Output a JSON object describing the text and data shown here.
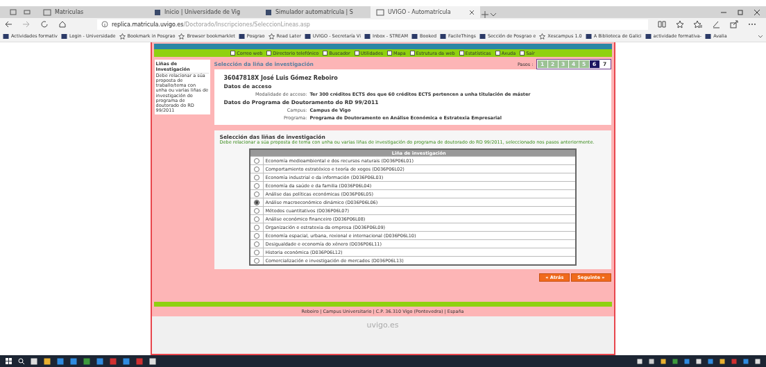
{
  "browser": {
    "tabs": [
      {
        "label": "Matriculas",
        "selected": false
      },
      {
        "label": "Inicio | Universidade de Vig",
        "selected": false
      },
      {
        "label": "Simulador automatrícula | S",
        "selected": false
      },
      {
        "label": "UVIGO - Automatrícula",
        "selected": true
      }
    ],
    "address": {
      "host": "replica.matricula.uvigo.es",
      "path": "/Doctorado/Inscripciones/SeleccionLineas.asp"
    },
    "bookmarks": [
      {
        "label": "Actividades formativ",
        "kind": "site"
      },
      {
        "label": "Login - Universidade",
        "kind": "site"
      },
      {
        "label": "Bookmark in Posgrao",
        "kind": "star"
      },
      {
        "label": "Browser bookmarklet",
        "kind": "star"
      },
      {
        "label": "Posgrao",
        "kind": "site"
      },
      {
        "label": "Read Later",
        "kind": "star"
      },
      {
        "label": "UVIGO - Secretaría Vi",
        "kind": "site"
      },
      {
        "label": "Inbox - STREAM",
        "kind": "site"
      },
      {
        "label": "Booked",
        "kind": "site"
      },
      {
        "label": "FacileThings",
        "kind": "site"
      },
      {
        "label": "Sección de Posgrao e",
        "kind": "site"
      },
      {
        "label": "Xescampus 1.0",
        "kind": "star"
      },
      {
        "label": "A Biblioteca de Galici",
        "kind": "site"
      },
      {
        "label": "actividade formativa-",
        "kind": "site"
      },
      {
        "label": "Avalia",
        "kind": "site"
      }
    ]
  },
  "page": {
    "nav_links": [
      "Correo web",
      "Directorio telefónico",
      "Buscador",
      "Utilidades",
      "Mapa",
      "Estrutura da web",
      "Estatísticas",
      "Axuda",
      "Saír"
    ],
    "sidebar": {
      "title": "Liñas de Investigación",
      "text": "Debe relacionar a súa proposta de traballo/tema con unha ou varias liñas de investigación do programa de doutorado do RD 99/2011"
    },
    "heading": "Selección da liña de investigación",
    "steps_label": "Pasos :",
    "steps": [
      {
        "label": "1",
        "completed": true,
        "selected": false
      },
      {
        "label": "2",
        "completed": true,
        "selected": false
      },
      {
        "label": "3",
        "completed": true,
        "selected": false
      },
      {
        "label": "4",
        "completed": true,
        "selected": false
      },
      {
        "label": "5",
        "completed": true,
        "selected": false
      },
      {
        "label": "6",
        "completed": false,
        "selected": true
      },
      {
        "label": "7",
        "completed": false,
        "selected": false
      }
    ],
    "student": "36047818X José Luis Gómez Reboiro",
    "access_heading": "Datos de acceso",
    "access_fields": [
      {
        "label": "Modalidade de acceso:",
        "value": "Ter 300 créditos ECTS dos que 60 créditos ECTS pertencen a unha titulación de máster"
      }
    ],
    "program_heading": "Datos do Programa de Doutoramento do RD 99/2011",
    "program_fields": [
      {
        "label": "Campus:",
        "value": "Campus de Vigo"
      },
      {
        "label": "Programa:",
        "value": "Programa de Doutoramento en Análise Económica e Estratexia Empresarial"
      }
    ],
    "section_title": "Selección das liñas de investigación",
    "section_text": "Debe relacionar a súa proposta de tema con unha ou varias liñas de investigación do programa de doutorado do RD 99/2011, seleccionado nos pasos anteriormente.",
    "table": {
      "column": "Liña de investigación",
      "rows": [
        {
          "label": "Economía medioambiental e dos recursos naturais (D036P06L01)",
          "selected": false
        },
        {
          "label": "Comportamiento estratéxico e teoría de xogos (D036P06L02)",
          "selected": false
        },
        {
          "label": "Economía industrial e da información (D036P06L03)",
          "selected": false
        },
        {
          "label": "Economía da saúde e da familia (D036P06L04)",
          "selected": false
        },
        {
          "label": "Análise das políticas económicas (D036P06L05)",
          "selected": false
        },
        {
          "label": "Análise macroeconómico dinámico (D036P06L06)",
          "selected": true
        },
        {
          "label": "Métodos cuantitativos (D036P06L07)",
          "selected": false
        },
        {
          "label": "Análise económico financeiro (D036P06L08)",
          "selected": false
        },
        {
          "label": "Organización e estratexia da empresa (D036P06L09)",
          "selected": false
        },
        {
          "label": "Economía espacial, urbana, rexional e internacional (D036P06L10)",
          "selected": false
        },
        {
          "label": "Desigualdade e economía do xénero (D036P06L11)",
          "selected": false
        },
        {
          "label": "Historia económica (D036P06L12)",
          "selected": false
        },
        {
          "label": "Comercialización e investigación de mercados (D036P06L13)",
          "selected": false
        }
      ]
    },
    "buttons": [
      "« Atrás",
      "Seguinte »"
    ],
    "footer": "Reboiro | Campus Universitario | C.P. 36.310 Vigo (Pontevedra) | España",
    "logo": "uvigo.es"
  }
}
